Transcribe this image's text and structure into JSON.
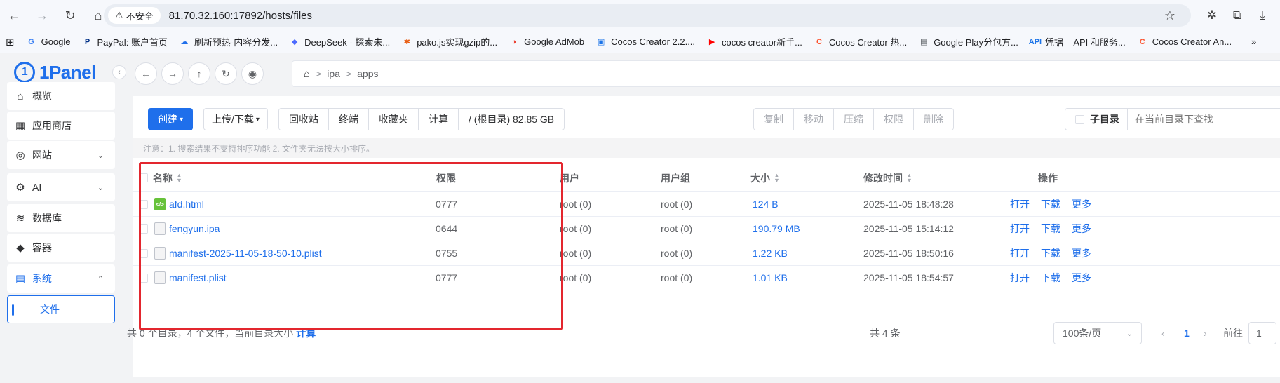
{
  "browser": {
    "security_label": "不安全",
    "url": "81.70.32.160:17892/hosts/files",
    "bookmarks": [
      {
        "label": "Google",
        "icon": "G",
        "color": "#4285f4"
      },
      {
        "label": "PayPal: 账户首页",
        "icon": "P",
        "color": "#003087"
      },
      {
        "label": "刷新预热-内容分发...",
        "icon": "☁",
        "color": "#1f6feb"
      },
      {
        "label": "DeepSeek - 探索未...",
        "icon": "◆",
        "color": "#4d6bfe"
      },
      {
        "label": "pako.js实现gzip的...",
        "icon": "✱",
        "color": "#e8590c"
      },
      {
        "label": "Google AdMob",
        "icon": "◑",
        "color": "#ea4335"
      },
      {
        "label": "Cocos Creator 2.2....",
        "icon": "▣",
        "color": "#1a73e8"
      },
      {
        "label": "cocos creator新手...",
        "icon": "▶",
        "color": "#ff0000"
      },
      {
        "label": "Cocos Creator 热...",
        "icon": "C",
        "color": "#fc5531"
      },
      {
        "label": "Google Play分包方...",
        "icon": "▤",
        "color": "#5f6368"
      },
      {
        "label": "凭据 – API 和服务...",
        "icon": "API",
        "color": "#1a73e8"
      },
      {
        "label": "Cocos Creator An...",
        "icon": "C",
        "color": "#fc5531"
      }
    ]
  },
  "app": {
    "brand": "1Panel",
    "menu": [
      {
        "label": "概览",
        "icon": "⌂"
      },
      {
        "label": "应用商店",
        "icon": "▦"
      },
      {
        "label": "网站",
        "icon": "◎"
      },
      {
        "label": "AI",
        "icon": "⚙"
      },
      {
        "label": "数据库",
        "icon": "≋"
      },
      {
        "label": "容器",
        "icon": "◆"
      },
      {
        "label": "系统",
        "icon": "▤"
      },
      {
        "label": "文件",
        "icon": ""
      }
    ]
  },
  "breadcrumb": [
    "ipa",
    "apps"
  ],
  "toolbar": {
    "create_label": "创建",
    "upload_download_label": "上传/下载",
    "group": [
      "回收站",
      "终端",
      "收藏夹",
      "计算",
      "/ (根目录) 82.85 GB"
    ],
    "batch": [
      "复制",
      "移动",
      "压缩",
      "权限",
      "删除"
    ],
    "subdir_label": "子目录",
    "search_placeholder": "在当前目录下查找"
  },
  "notice": "注意：1. 搜索结果不支持排序功能 2. 文件夹无法按大小排序。",
  "table": {
    "headers": {
      "name": "名称",
      "perm": "权限",
      "user": "用户",
      "group": "用户组",
      "size": "大小",
      "mtime": "修改时间",
      "ops": "操作"
    },
    "rows": [
      {
        "name": "afd.html",
        "type": "html",
        "perm": "0777",
        "user": "root (0)",
        "group": "root (0)",
        "size": "124 B",
        "mtime": "2025-11-05 18:48:28"
      },
      {
        "name": "fengyun.ipa",
        "type": "doc",
        "perm": "0644",
        "user": "root (0)",
        "group": "root (0)",
        "size": "190.79 MB",
        "mtime": "2025-11-05 15:14:12"
      },
      {
        "name": "manifest-2025-11-05-18-50-10.plist",
        "type": "doc",
        "perm": "0755",
        "user": "root (0)",
        "group": "root (0)",
        "size": "1.22 KB",
        "mtime": "2025-11-05 18:50:16"
      },
      {
        "name": "manifest.plist",
        "type": "doc",
        "perm": "0777",
        "user": "root (0)",
        "group": "root (0)",
        "size": "1.01 KB",
        "mtime": "2025-11-05 18:54:57"
      }
    ],
    "actions": {
      "open": "打开",
      "download": "下载",
      "more": "更多"
    }
  },
  "footer": {
    "summary": "共 0 个目录，4 个文件，当前目录大小",
    "calc": "计算",
    "total": "共 4 条",
    "page_size": "100条/页",
    "current_page": "1",
    "goto_label": "前往",
    "goto_value": "1"
  },
  "colors": {
    "accent": "#1f6feb",
    "highlight_box": "#e3262e"
  }
}
